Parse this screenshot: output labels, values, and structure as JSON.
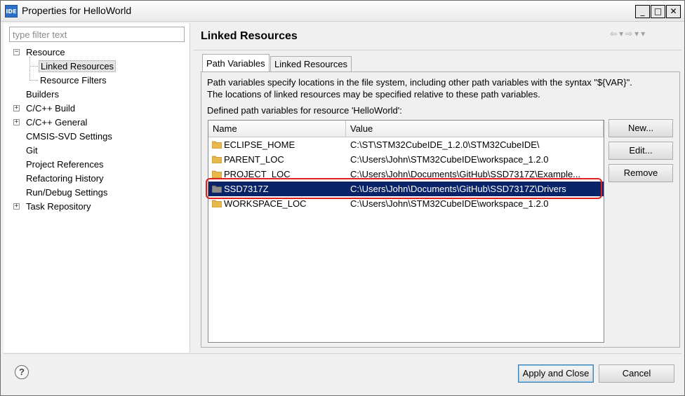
{
  "window": {
    "title": "Properties for HelloWorld",
    "icon_label": "IDE",
    "minimize_glyph": "_",
    "maximize_glyph": "□",
    "close_glyph": "✕"
  },
  "filter": {
    "placeholder": "type filter text",
    "value": ""
  },
  "tree": {
    "items": [
      {
        "label": "Resource",
        "expander": "−"
      },
      {
        "label": "Linked Resources",
        "selected": true
      },
      {
        "label": "Resource Filters"
      },
      {
        "label": "Builders"
      },
      {
        "label": "C/C++ Build",
        "expander": "+"
      },
      {
        "label": "C/C++ General",
        "expander": "+"
      },
      {
        "label": "CMSIS-SVD Settings"
      },
      {
        "label": "Git"
      },
      {
        "label": "Project References"
      },
      {
        "label": "Refactoring History"
      },
      {
        "label": "Run/Debug Settings"
      },
      {
        "label": "Task Repository",
        "expander": "+"
      }
    ]
  },
  "header": {
    "title": "Linked Resources",
    "nav_icons": [
      "back-icon",
      "back-menu-icon",
      "forward-icon",
      "forward-menu-icon",
      "view-menu-icon"
    ]
  },
  "tabs": [
    {
      "label": "Path Variables",
      "active": true
    },
    {
      "label": "Linked Resources",
      "active": false
    }
  ],
  "description": {
    "line1": "Path variables specify locations in the file system, including other path variables with the syntax \"${VAR}\".",
    "line2": "The locations of linked resources may be specified relative to these path variables.",
    "line3": "Defined path variables for resource 'HelloWorld':"
  },
  "table": {
    "columns": [
      "Name",
      "Value"
    ],
    "rows": [
      {
        "name": "ECLIPSE_HOME",
        "value": "C:\\ST\\STM32CubeIDE_1.2.0\\STM32CubeIDE\\"
      },
      {
        "name": "PARENT_LOC",
        "value": "C:\\Users\\John\\STM32CubeIDE\\workspace_1.2.0"
      },
      {
        "name": "PROJECT_LOC",
        "value": "C:\\Users\\John\\Documents\\GitHub\\SSD7317Z\\Example..."
      },
      {
        "name": "SSD7317Z",
        "value": "C:\\Users\\John\\Documents\\GitHub\\SSD7317Z\\Drivers",
        "selected": true
      },
      {
        "name": "WORKSPACE_LOC",
        "value": "C:\\Users\\John\\STM32CubeIDE\\workspace_1.2.0"
      }
    ]
  },
  "side_buttons": {
    "new": "New...",
    "edit": "Edit...",
    "remove": "Remove"
  },
  "footer": {
    "help_glyph": "?",
    "apply_close": "Apply and Close",
    "cancel": "Cancel"
  },
  "colors": {
    "selection": "#0a246a",
    "highlight_ring": "#e02020",
    "folder": "#e8b84a"
  }
}
